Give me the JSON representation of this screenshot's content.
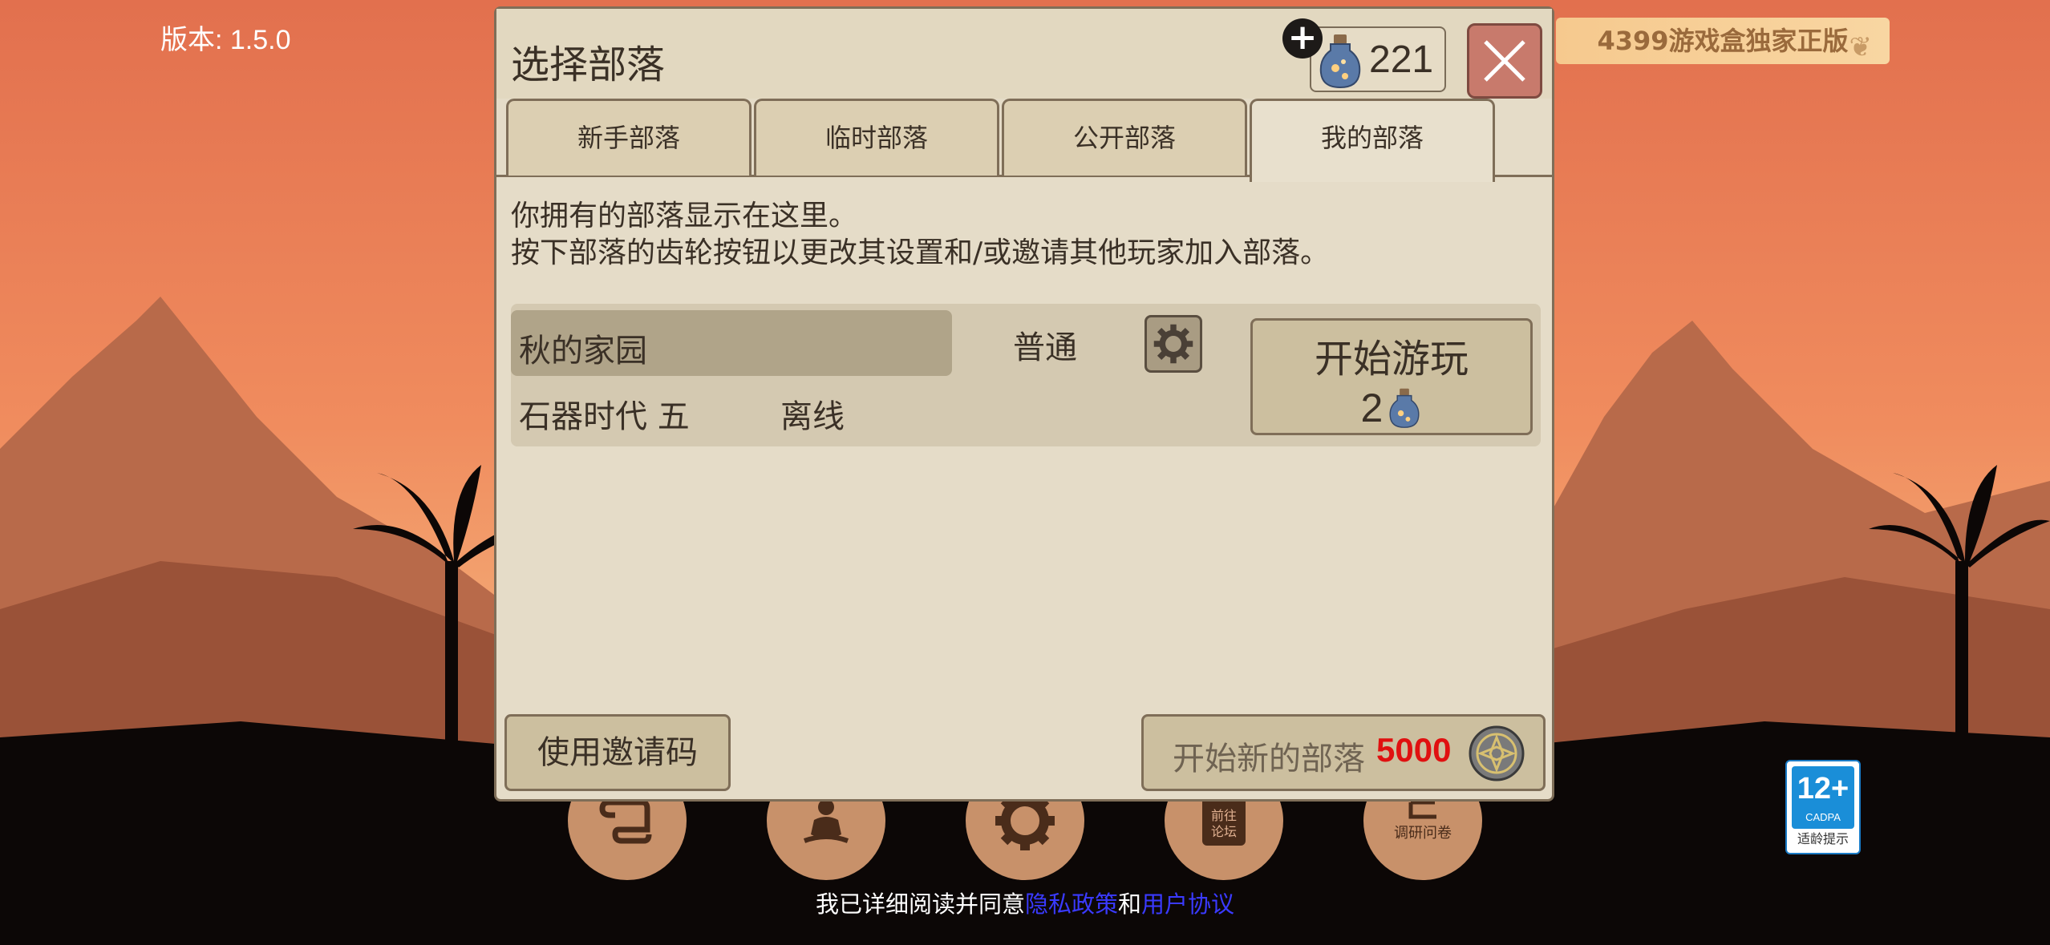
{
  "version_label": "版本: 1.5.0",
  "banner_text": "4399游戏盒独家正版",
  "age_badge": {
    "age": "12+",
    "org": "CADPA",
    "tip": "适龄提示"
  },
  "panel": {
    "title": "选择部落",
    "gem_count": "221",
    "add_symbol": "+",
    "tabs": [
      "新手部落",
      "临时部落",
      "公开部落",
      "我的部落"
    ],
    "active_tab": "我的部落",
    "description_line1": "你拥有的部落显示在这里。",
    "description_line2": "按下部落的齿轮按钮以更改其设置和/或邀请其他玩家加入部落。",
    "tribe": {
      "name": "秋的家园",
      "mode": "普通",
      "era": "石器时代 五",
      "status": "离线",
      "play_label": "开始游玩",
      "play_cost": "2"
    },
    "invite_button": "使用邀请码",
    "new_tribe_label": "开始新的部落",
    "new_tribe_cost": "5000"
  },
  "agreement": {
    "prefix": "我已详细阅读并同意",
    "privacy": "隐私政策",
    "and": "和",
    "terms": "用户协议"
  },
  "bottom_icons": [
    "scroll-icon",
    "meditation-icon",
    "gear-icon",
    "forum-icon",
    "survey-icon"
  ],
  "bottom_icon_text": {
    "forum": "前往论坛",
    "survey": "调研问卷"
  },
  "colors": {
    "panel_bg": "#e5dcc8",
    "cost_red": "#e01010",
    "close_bg": "#c87a6c",
    "link_blue": "#3a3aff"
  }
}
